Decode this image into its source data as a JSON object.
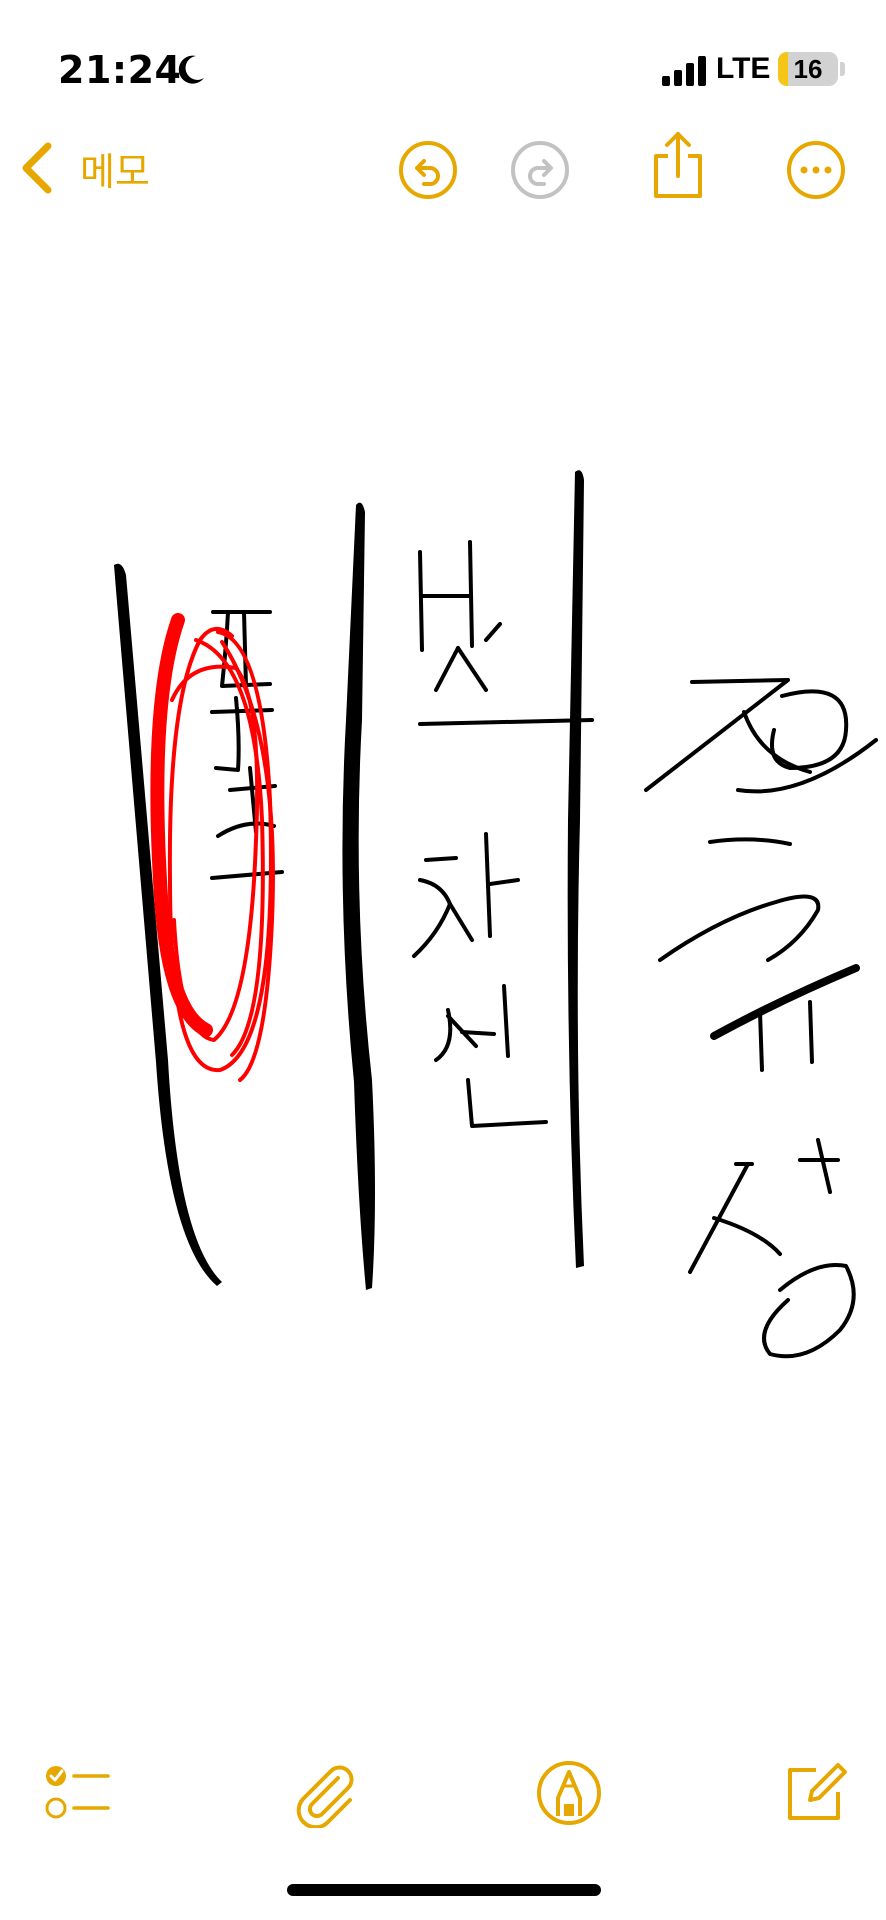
{
  "status_bar": {
    "time": "21:24",
    "network": "LTE",
    "battery_level": "16",
    "battery_fraction": 0.16,
    "icons": [
      "moon-icon",
      "signal-icon"
    ]
  },
  "nav_bar": {
    "back_label": "메모",
    "icons": [
      "back-chevron-icon",
      "undo-icon",
      "redo-icon",
      "share-icon",
      "more-icon"
    ],
    "redo_enabled": false
  },
  "bottom_toolbar": {
    "icons": [
      "checklist-icon",
      "attachment-icon",
      "markup-pen-icon",
      "compose-icon"
    ]
  },
  "colors": {
    "accent": "#e6a800",
    "disabled": "#c2c2c2",
    "ink_black": "#000000",
    "ink_red": "#ff0000",
    "battery_fill": "#f5c518"
  }
}
